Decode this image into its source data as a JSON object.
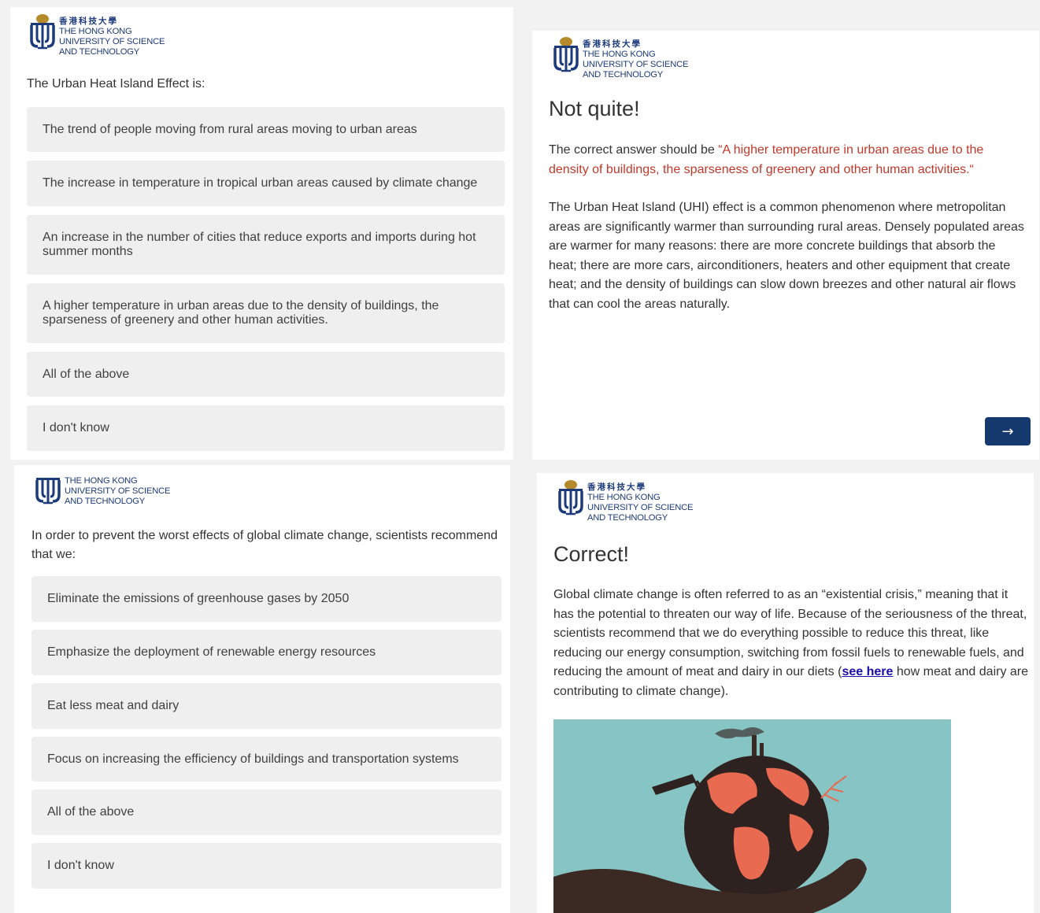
{
  "logo": {
    "chinese": "香港科技大學",
    "line1": "THE HONG KONG",
    "line2": "UNIVERSITY OF SCIENCE",
    "line3": "AND TECHNOLOGY"
  },
  "colors": {
    "brand_navy": "#1d3b7a",
    "brand_gold": "#b58a2a",
    "option_bg": "#efefef",
    "accent_red": "#c0392b",
    "button": "#163a6e"
  },
  "quiz1": {
    "question": "The Urban Heat Island Effect is:",
    "options": [
      "The trend of people moving from rural areas moving to urban areas",
      "The increase in temperature in tropical urban areas caused by climate change",
      "An increase in the number of cities that reduce exports and imports during hot summer months",
      "A higher temperature in urban areas due to the density of buildings, the sparseness of greenery and other human activities.",
      "All of the above",
      "I don't know"
    ]
  },
  "feedback1": {
    "title": "Not quite!",
    "correct_prefix": "The correct answer should be ",
    "correct_answer": "“A higher temperature in urban areas due to the density of buildings, the sparseness of greenery and other human activities.“",
    "body": "The Urban Heat Island (UHI) effect is a common phenomenon where metropolitan areas are significantly warmer than surrounding rural areas.  Densely populated areas are warmer for many reasons: there are more concrete buildings that absorb the heat; there are more cars, airconditioners, heaters and other equipment that create heat; and the density of buildings can slow down breezes and other natural air flows that can cool the areas naturally.",
    "next_icon": "right-arrow-icon",
    "next_label": "→"
  },
  "quiz2": {
    "question": "In order to prevent the worst effects of global climate change, scientists recommend that we:",
    "options": [
      "Eliminate the emissions of greenhouse gases by 2050",
      "Emphasize the deployment of renewable energy resources",
      "Eat less meat and dairy",
      "Focus on increasing the efficiency of buildings and transportation systems",
      "All of the above",
      "I don't know"
    ]
  },
  "feedback2": {
    "title": "Correct!",
    "body_before_link": "Global climate change is often referred to as an “existential crisis,” meaning that it has the potential to threaten our way of life. Because of the seriousness of the threat, scientists recommend that we do everything possible to reduce this threat, like reducing our energy consumption, switching from fossil fuels to renewable fuels, and reducing the amount of meat and dairy in our diets (",
    "link_text": "see here",
    "body_after_link": " how meat and dairy are contributing to climate change).",
    "image_icon": "globe-in-hand-illustration"
  }
}
